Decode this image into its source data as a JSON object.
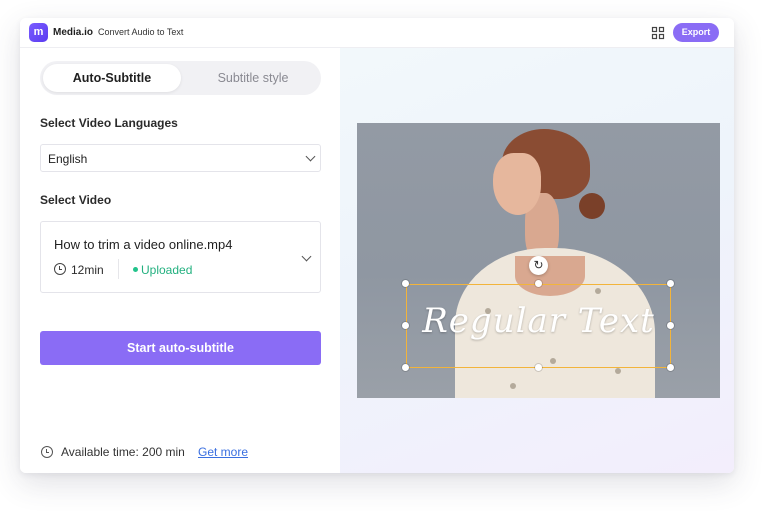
{
  "app": {
    "brand": "Media.io",
    "logo_glyph": "m",
    "breadcrumb": "Convert Audio to Text",
    "export_label": "Export",
    "accent_color": "#8a6cf5"
  },
  "tabs": [
    {
      "label": "Auto-Subtitle",
      "active": true
    },
    {
      "label": "Subtitle style",
      "active": false
    }
  ],
  "languages": {
    "label": "Select Video Languages",
    "selected": "English"
  },
  "video": {
    "label": "Select Video",
    "file_name": "How to trim a video online.mp4",
    "duration": "12min",
    "status": "Uploaded",
    "status_color": "#22b07f"
  },
  "actions": {
    "start_label": "Start auto-subtitle"
  },
  "footer": {
    "available_time": "Available time: 200 min",
    "get_more": "Get more"
  },
  "preview": {
    "overlay_text": "Regular Text",
    "rotate_icon": "↻",
    "selection_color": "#f2b43b"
  }
}
